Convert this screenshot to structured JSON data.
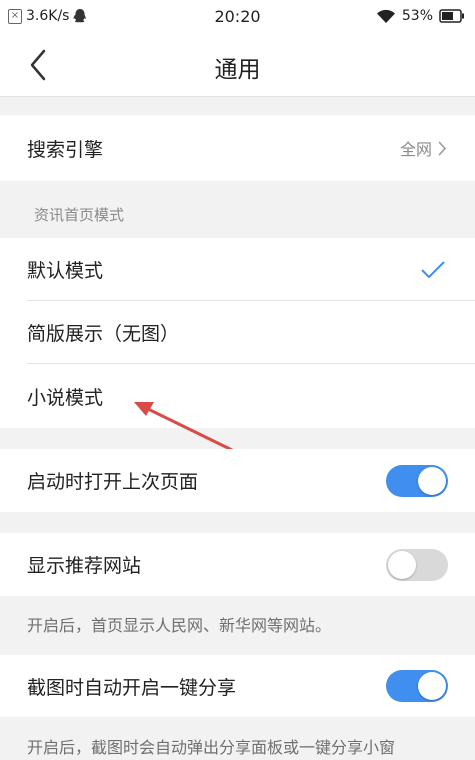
{
  "status_bar": {
    "speed": "3.6K/s",
    "time": "20:20",
    "battery": "53%"
  },
  "nav": {
    "title": "通用"
  },
  "search_engine": {
    "label": "搜索引擎",
    "value": "全网"
  },
  "home_mode": {
    "header": "资讯首页模式",
    "options": [
      {
        "label": "默认模式",
        "selected": true
      },
      {
        "label": "简版展示（无图）",
        "selected": false
      },
      {
        "label": "小说模式",
        "selected": false
      }
    ]
  },
  "restore_last_page": {
    "label": "启动时打开上次页面",
    "enabled": true
  },
  "recommended_sites": {
    "label": "显示推荐网站",
    "enabled": false,
    "note": "开启后，首页显示人民网、新华网等网站。"
  },
  "screenshot_share": {
    "label": "截图时自动开启一键分享",
    "enabled": true,
    "note": "开启后，截图时会自动弹出分享面板或一键分享小窗"
  },
  "colors": {
    "accent": "#3f8ef0",
    "annotation_arrow": "#d94b46"
  }
}
